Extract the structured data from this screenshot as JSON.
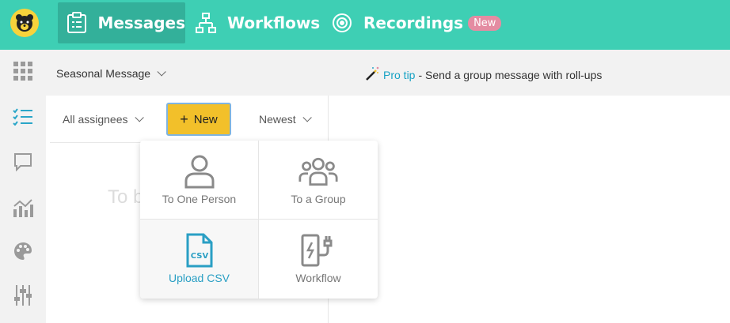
{
  "nav": {
    "messages": "Messages",
    "workflows": "Workflows",
    "recordings": "Recordings",
    "recordings_badge": "New"
  },
  "subheader": {
    "selector": "Seasonal Message",
    "protip_link": "Pro tip",
    "protip_text": "- Send a group message with roll-ups"
  },
  "filters": {
    "assignees": "All assignees",
    "new_button": "New",
    "sort": "Newest"
  },
  "placeholder_text": "To b",
  "menu": {
    "one_person": "To One Person",
    "group": "To a Group",
    "upload_csv": "Upload CSV",
    "workflow": "Workflow"
  },
  "colors": {
    "topbar": "#3ecfb4",
    "active_tab": "#33b09a",
    "new_button": "#f2c02a",
    "link": "#17a2c4",
    "badge": "#e48ca2"
  },
  "icons": {
    "rail": [
      "apps-grid-icon",
      "checklist-icon",
      "chat-bubble-icon",
      "chart-icon",
      "palette-icon",
      "sliders-icon"
    ],
    "menu": [
      "person-icon",
      "group-icon",
      "csv-file-icon",
      "ev-charger-icon"
    ]
  }
}
